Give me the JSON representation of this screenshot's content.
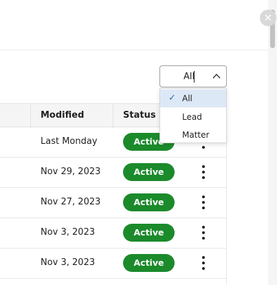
{
  "close_icon": "close-icon",
  "filter": {
    "value": "All",
    "options": [
      "All",
      "Lead",
      "Matter"
    ],
    "selected_index": 0
  },
  "table": {
    "headers": {
      "modified": "Modified",
      "status": "Status"
    },
    "rows": [
      {
        "modified": "Last Monday",
        "status": "Active"
      },
      {
        "modified": "Nov 29, 2023",
        "status": "Active"
      },
      {
        "modified": "Nov 27, 2023",
        "status": "Active"
      },
      {
        "modified": "Nov 3, 2023",
        "status": "Active"
      },
      {
        "modified": "Nov 3, 2023",
        "status": "Active"
      }
    ]
  },
  "colors": {
    "status_active": "#1b8a2b",
    "selected_option": "#dde8f7",
    "check": "#2b6cb0"
  }
}
